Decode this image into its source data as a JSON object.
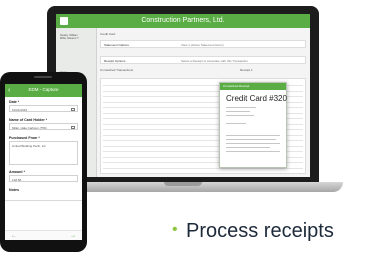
{
  "laptop": {
    "app": {
      "title": "Construction Partners, Ltd.",
      "sidebar_user": [
        "Nealey, William",
        "Miller, Eleanor T."
      ],
      "sidebar_items": [
        "Home",
        "Expense",
        "Receipts",
        "Travel"
      ],
      "breadcrumb": "Credit Card",
      "fields": [
        {
          "label": "Statement Options",
          "value": "View 1 (Active Statement Items)"
        },
        {
          "label": "Receipt Options",
          "value": "Select a Receipt to Associate with this Transaction"
        }
      ],
      "table_title": "Unmatched Transactions",
      "table_section_label": "Receipt 1"
    },
    "popup": {
      "header": "Unmatched Receipt",
      "title": "Credit Card #320"
    }
  },
  "phone": {
    "header": "EDM - Capture",
    "labels": {
      "date": "Date *",
      "card_holder": "Name of Card Holder *",
      "purchased_from": "Purchased From *",
      "amount": "Amount *",
      "notes": "Notes"
    },
    "values": {
      "date": "10/21/2019",
      "card_holder": "Miller, Hale Carlston (756)",
      "purchased_from": "United Building Perth, Inc",
      "amount": "128.56"
    },
    "nav": {
      "prev": "←",
      "next": "→"
    },
    "back": "‹"
  },
  "caption": {
    "bullet": "•",
    "text": "Process receipts"
  }
}
